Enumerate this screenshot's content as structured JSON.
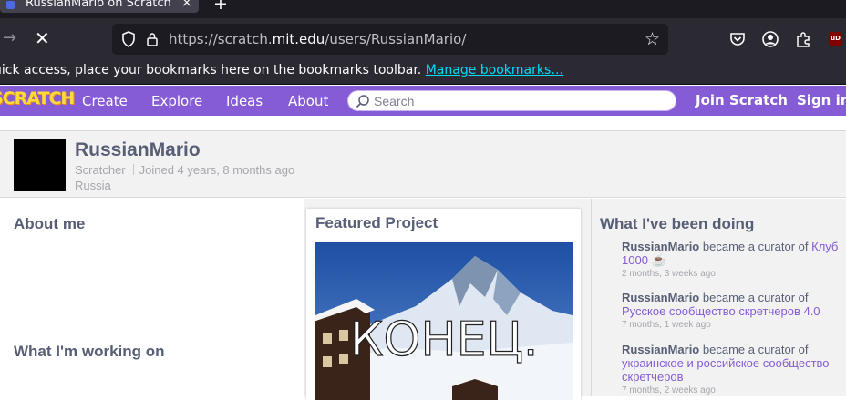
{
  "browser": {
    "tab_title": "RussianMario on Scratch",
    "tab_close": "×",
    "new_tab": "+",
    "url_prefix": "https://scratch.",
    "url_domain": "mit.edu",
    "url_path": "/users/RussianMario/",
    "bookmarks_text": "uick access, place your bookmarks here on the bookmarks toolbar.",
    "bookmarks_link": "Manage bookmarks…",
    "ublock_label": "uD"
  },
  "scratch_nav": {
    "logo": "SCRATCH",
    "create": "Create",
    "explore": "Explore",
    "ideas": "Ideas",
    "about": "About",
    "search_placeholder": "Search",
    "join": "Join Scratch",
    "sign_in": "Sign in"
  },
  "profile": {
    "username": "RussianMario",
    "role": "Scratcher",
    "joined": "Joined 4 years, 8 months ago",
    "location": "Russia"
  },
  "sections": {
    "about_me": "About me",
    "working_on": "What I'm working on",
    "featured": "Featured Project",
    "activity": "What I've been doing"
  },
  "featured_project": {
    "image_text": "КОНЕЦ."
  },
  "activity": [
    {
      "user": "RussianMario",
      "action": "became a curator of",
      "target": "Клуб 1000 ☕",
      "time": "2 months, 3 weeks ago"
    },
    {
      "user": "RussianMario",
      "action": "became a curator of",
      "target": "Русское сообщество скретчеров 4.0",
      "time": "7 months, 1 week ago"
    },
    {
      "user": "RussianMario",
      "action": "became a curator of",
      "target": "украинское и российское сообщество скретчеров",
      "time": "7 months, 2 weeks ago"
    }
  ],
  "colors": {
    "scratch_purple": "#855cd6",
    "text_gray": "#575e75",
    "link_purple": "#855cd6"
  }
}
